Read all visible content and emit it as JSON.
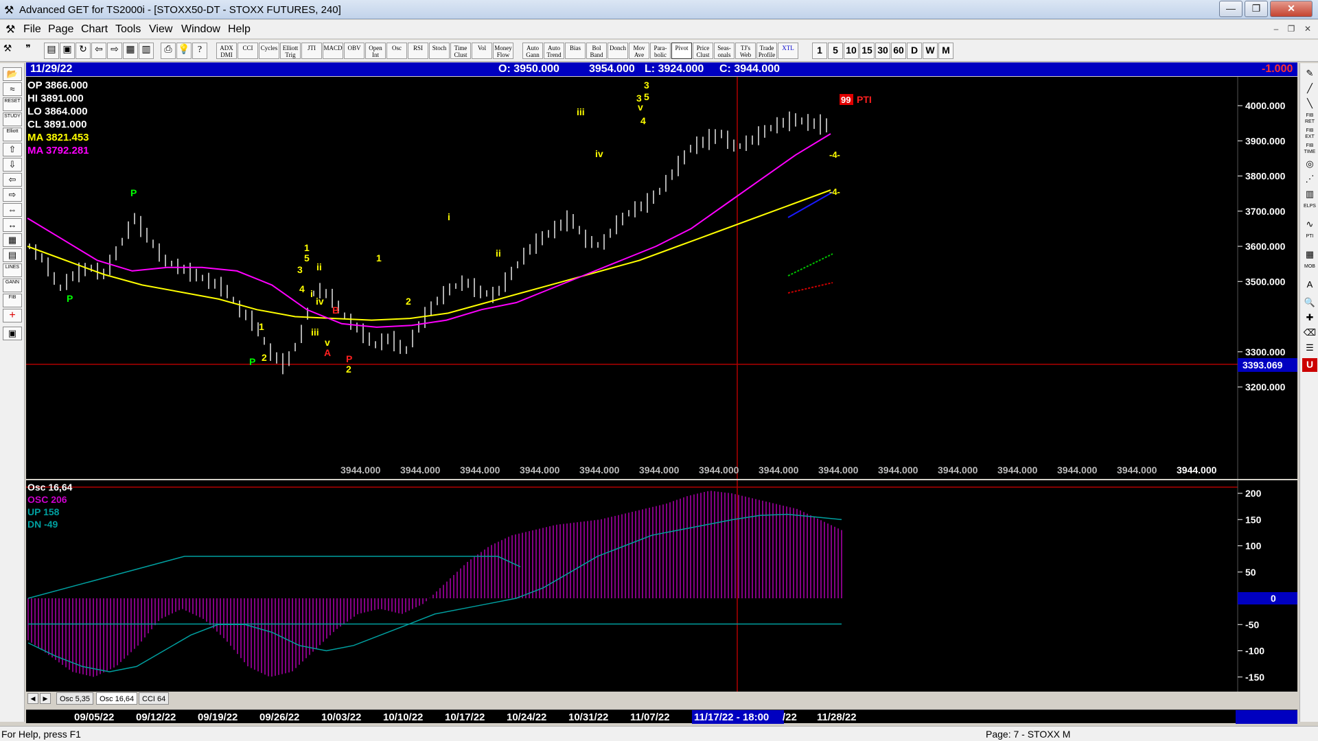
{
  "window": {
    "title": "Advanced GET for TS2000i - [STOXX50-DT - STOXX FUTURES, 240]"
  },
  "menu": [
    "File",
    "Page",
    "Chart",
    "Tools",
    "View",
    "Window",
    "Help"
  ],
  "toolbar": {
    "study_buttons": [
      "ADX DMI",
      "CCI",
      "Cycles",
      "Elliott Trig",
      "JTI",
      "MACD",
      "OBV",
      "Open Int",
      "Osc",
      "RSI",
      "Stoch",
      "Time Clust",
      "Vol",
      "Money Flow",
      "Auto Gann",
      "Auto Trend",
      "Bias",
      "Bol Band",
      "Donch",
      "Mov Ave",
      "Para-bolic",
      "Pivot",
      "Price Clust",
      "Seas-onals",
      "TJ's Web",
      "Trade Profile",
      "XTL"
    ],
    "time_buttons": [
      "1",
      "5",
      "10",
      "15",
      "30",
      "60",
      "D",
      "W",
      "M"
    ]
  },
  "left_tools": [
    "RESET",
    "STUDY",
    "Elliott",
    "LINES",
    "GANN",
    "FIB"
  ],
  "right_tools": [
    "FIB RET",
    "FIB EXT",
    "FIB TIME",
    "ELPS",
    "PTI",
    "MOB"
  ],
  "header": {
    "date": "11/29/22",
    "open": "O: 3950.000",
    "high": "3954.000",
    "low": "L: 3924.000",
    "close": "C: 3944.000",
    "change": "-1.000"
  },
  "ohlc_panel": {
    "op": "OP  3866.000",
    "hi": "HI   3891.000",
    "lo": "LO  3864.000",
    "cl": "CL  3891.000",
    "ma1": "MA  3821.453",
    "ma2": "MA  3792.281"
  },
  "price_axis": {
    "ticks": [
      "4000.000",
      "3900.000",
      "3800.000",
      "3700.000",
      "3600.000",
      "3500.000",
      "3300.000",
      "3200.000"
    ],
    "cursor_price": "3393.069"
  },
  "close_strip": [
    "3944.000",
    "3944.000",
    "3944.000",
    "3944.000",
    "3944.000",
    "3944.000",
    "3944.000",
    "3944.000",
    "3944.000",
    "3944.000",
    "3944.000",
    "3944.000",
    "3944.000",
    "3944.000",
    "3944.000"
  ],
  "pti": {
    "value": "99",
    "label": "PTI"
  },
  "projection_labels": [
    "-4-",
    "-4-"
  ],
  "osc_panel": {
    "title": "Osc 16,64",
    "osc": "OSC 206",
    "up": "UP   158",
    "dn": "DN   -49",
    "ticks": [
      "200",
      "150",
      "100",
      "50",
      "-50",
      "-100",
      "-150"
    ],
    "zero_label": "0"
  },
  "tabs": [
    "Osc 5,35",
    "Osc 16,64",
    "CCI 64"
  ],
  "date_axis": {
    "labels": [
      "09/05/22",
      "09/12/22",
      "09/19/22",
      "09/26/22",
      "10/03/22",
      "10/10/22",
      "10/17/22",
      "10/24/22",
      "10/31/22",
      "11/07/22",
      "/22",
      "11/28/22"
    ],
    "cursor_label": "11/17/22 - 18:00"
  },
  "statusbar": {
    "help": "For Help, press F1",
    "page": "Page: 7 - STOXX M"
  },
  "colors": {
    "ma_fast": "#ffff00",
    "ma_slow": "#ff00ff",
    "wave_labels": "#ffff00",
    "pivot_green": "#00ff00",
    "osc_bars": "#cc00cc",
    "osc_lines": "#00a0a0",
    "cursor_line": "#b00000"
  },
  "chart_data": {
    "type": "line",
    "ylim": [
      3150,
      4050
    ],
    "series": [
      {
        "values": [
          3600,
          3560,
          3520,
          3490,
          3470,
          3450,
          3420,
          3400,
          3395,
          3390,
          3395,
          3410,
          3440,
          3470,
          3500,
          3530,
          3560,
          3600,
          3640,
          3680,
          3720,
          3760,
          3790,
          3820
        ]
      },
      {
        "values": [
          3680,
          3620,
          3560,
          3530,
          3540,
          3540,
          3530,
          3490,
          3420,
          3380,
          3370,
          3375,
          3390,
          3420,
          3440,
          3480,
          3520,
          3560,
          3600,
          3650,
          3720,
          3790,
          3860,
          3920
        ]
      }
    ]
  }
}
